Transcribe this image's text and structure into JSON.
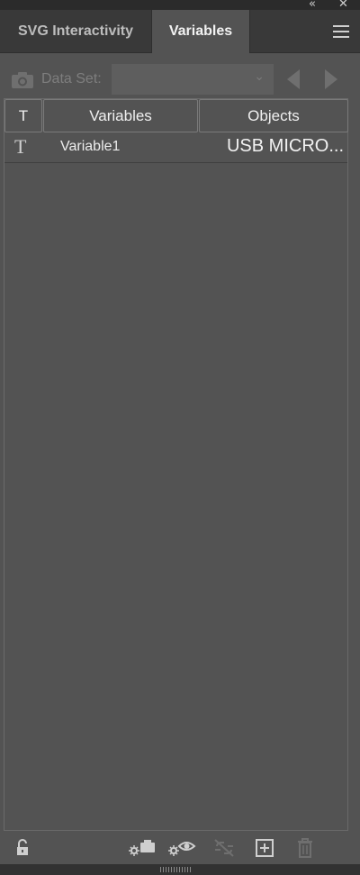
{
  "tabs": [
    {
      "label": "SVG Interactivity",
      "active": false
    },
    {
      "label": "Variables",
      "active": true
    }
  ],
  "toolbar": {
    "data_set_label": "Data Set:",
    "data_set_value": ""
  },
  "table": {
    "columns": [
      "T",
      "Variables",
      "Objects"
    ],
    "rows": [
      {
        "type_icon": "T",
        "variable": "Variable1",
        "object": "USB MICRO..."
      }
    ]
  },
  "icons": {
    "window_controls": [
      "collapse-icon",
      "close-icon"
    ],
    "bottom": [
      "lock-icon",
      "capture-data-set-icon",
      "make-visibility-dynamic-icon",
      "unbind-variable-icon",
      "new-variable-icon",
      "delete-variable-icon"
    ]
  },
  "colors": {
    "panel_bg": "#535353",
    "tabbar_bg": "#393939",
    "text": "#e8e8e8"
  }
}
